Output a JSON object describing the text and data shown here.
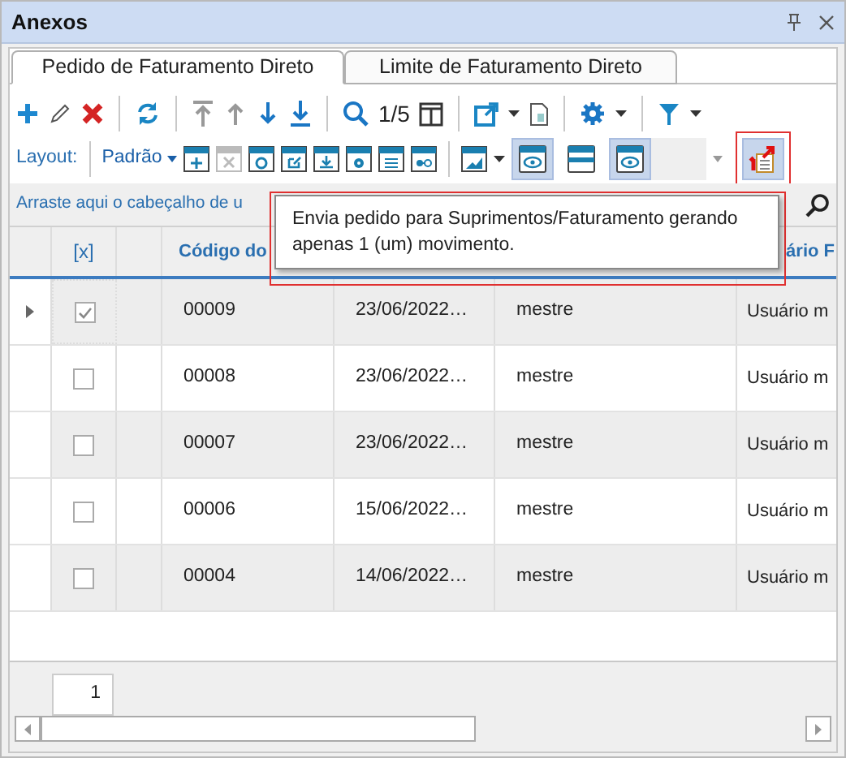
{
  "panel": {
    "title": "Anexos"
  },
  "tabs": [
    {
      "label": "Pedido de Faturamento Direto",
      "selected": true
    },
    {
      "label": "Limite de Faturamento Direto",
      "selected": false
    }
  ],
  "toolbar": {
    "page_indicator": "1/5",
    "layout_label": "Layout:",
    "layout_value": "Padrão",
    "toggles": [
      {
        "selected": true
      },
      {
        "selected": false
      },
      {
        "selected": true
      }
    ]
  },
  "group_hint": "Arraste aqui o cabeçalho de u",
  "tooltip": "Envia pedido para Suprimentos/Faturamento gerando apenas 1 (um) movimento.",
  "table": {
    "checkbox_header": "[x]",
    "columns": [
      "Código do",
      "",
      "",
      "ário F"
    ],
    "rows": [
      {
        "current": true,
        "checked": true,
        "cells": [
          "00009",
          "23/06/2022…",
          "mestre",
          "Usuário m"
        ]
      },
      {
        "current": false,
        "checked": false,
        "cells": [
          "00008",
          "23/06/2022…",
          "mestre",
          "Usuário m"
        ]
      },
      {
        "current": false,
        "checked": false,
        "cells": [
          "00007",
          "23/06/2022…",
          "mestre",
          "Usuário m"
        ]
      },
      {
        "current": false,
        "checked": false,
        "cells": [
          "00006",
          "15/06/2022…",
          "mestre",
          "Usuário m"
        ]
      },
      {
        "current": false,
        "checked": false,
        "cells": [
          "00004",
          "14/06/2022…",
          "mestre",
          "Usuário m"
        ]
      }
    ]
  },
  "pager": {
    "page": "1"
  }
}
